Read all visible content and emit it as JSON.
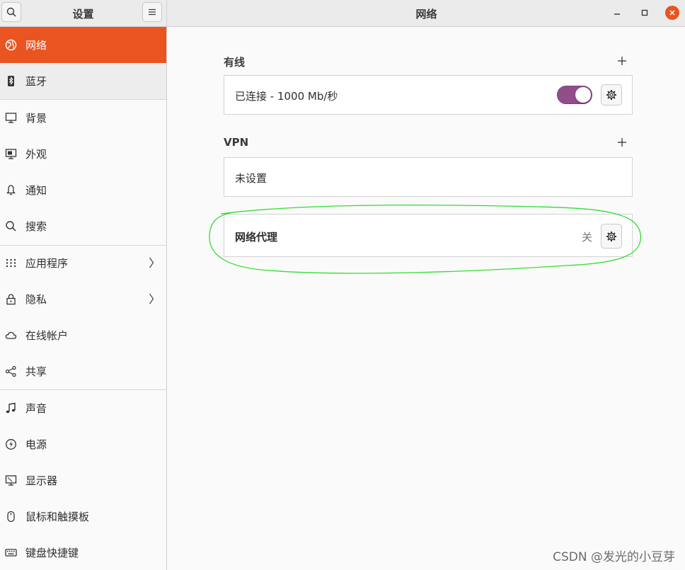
{
  "header": {
    "left_title": "设置",
    "title": "网络"
  },
  "sidebar": {
    "items": [
      {
        "label": "网络",
        "icon": "network-icon",
        "active": true
      },
      {
        "label": "蓝牙",
        "icon": "bluetooth-icon"
      },
      {
        "label": "背景",
        "icon": "background-icon"
      },
      {
        "label": "外观",
        "icon": "appearance-icon"
      },
      {
        "label": "通知",
        "icon": "bell-icon"
      },
      {
        "label": "搜索",
        "icon": "search-icon"
      },
      {
        "label": "应用程序",
        "icon": "apps-grid-icon",
        "has_chevron": true
      },
      {
        "label": "隐私",
        "icon": "lock-icon",
        "has_chevron": true
      },
      {
        "label": "在线帐户",
        "icon": "cloud-icon"
      },
      {
        "label": "共享",
        "icon": "share-icon"
      },
      {
        "label": "声音",
        "icon": "music-note-icon"
      },
      {
        "label": "电源",
        "icon": "power-icon"
      },
      {
        "label": "显示器",
        "icon": "monitor-icon"
      },
      {
        "label": "鼠标和触摸板",
        "icon": "mouse-icon"
      },
      {
        "label": "键盘快捷键",
        "icon": "keyboard-icon"
      }
    ]
  },
  "wired": {
    "title": "有线",
    "status": "已连接 - 1000 Mb/秒",
    "enabled": true
  },
  "vpn": {
    "title": "VPN",
    "status": "未设置"
  },
  "proxy": {
    "label": "网络代理",
    "status": "关"
  },
  "watermark": "CSDN @发光的小豆芽",
  "colors": {
    "accent": "#e95420",
    "toggle_on": "#924d8b",
    "annotation": "#33dd33"
  }
}
